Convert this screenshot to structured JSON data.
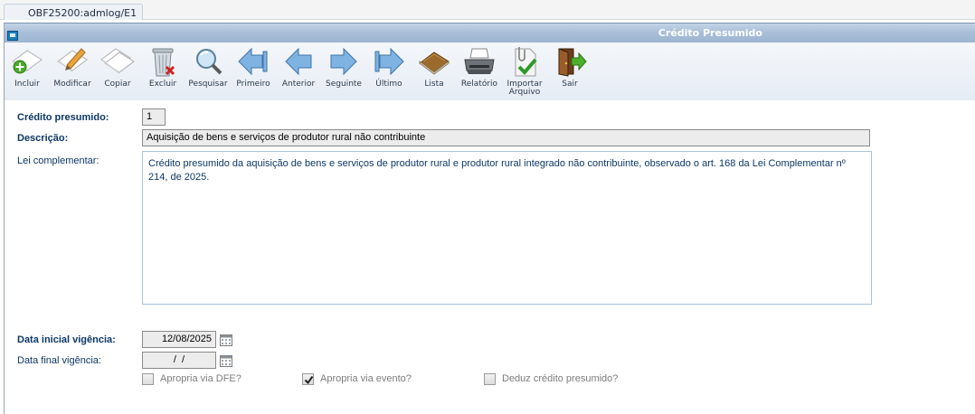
{
  "tab": {
    "label": "OBF25200:admlog/E1"
  },
  "window": {
    "title": "Crédito Presumido"
  },
  "toolbar": [
    {
      "id": "incluir",
      "label": "Incluir",
      "icon": "add-document-icon"
    },
    {
      "id": "modificar",
      "label": "Modificar",
      "icon": "edit-document-icon"
    },
    {
      "id": "copiar",
      "label": "Copiar",
      "icon": "copy-document-icon"
    },
    {
      "id": "excluir",
      "label": "Excluir",
      "icon": "trash-delete-icon"
    },
    {
      "id": "pesquisar",
      "label": "Pesquisar",
      "icon": "magnifier-icon"
    },
    {
      "id": "primeiro",
      "label": "Primeiro",
      "icon": "arrow-first-icon"
    },
    {
      "id": "anterior",
      "label": "Anterior",
      "icon": "arrow-left-icon"
    },
    {
      "id": "seguinte",
      "label": "Seguinte",
      "icon": "arrow-right-icon"
    },
    {
      "id": "ultimo",
      "label": "Último",
      "icon": "arrow-last-icon"
    },
    {
      "id": "lista",
      "label": "Lista",
      "icon": "book-list-icon"
    },
    {
      "id": "relatorio",
      "label": "Relatório",
      "icon": "printer-icon"
    },
    {
      "id": "importar",
      "label": "Importar Arquivo",
      "icon": "import-file-icon"
    },
    {
      "id": "sair",
      "label": "Sair",
      "icon": "exit-door-icon"
    }
  ],
  "form": {
    "credito": {
      "label": "Crédito presumido:",
      "value": "1"
    },
    "descricao": {
      "label": "Descrição:",
      "value": "Aquisição de bens e serviços de produtor rural não contribuinte"
    },
    "lei": {
      "label": "Lei complementar:",
      "value": "Crédito presumido da aquisição de bens e serviços de produtor rural e produtor rural integrado não contribuinte, observado o art. 168 da Lei Complementar nº 214, de 2025."
    },
    "data_inicial": {
      "label": "Data inicial vigência:",
      "value": "12/08/2025"
    },
    "data_final": {
      "label": "Data final vigência:",
      "value": " /  / "
    }
  },
  "checkboxes": [
    {
      "label": "Apropria via DFE?",
      "checked": false
    },
    {
      "label": "Apropria via evento?",
      "checked": true
    },
    {
      "label": "Deduz crédito presumido?",
      "checked": false
    }
  ],
  "colors": {
    "label_blue": "#0c3766",
    "titlebar": "#a9bfd9"
  }
}
